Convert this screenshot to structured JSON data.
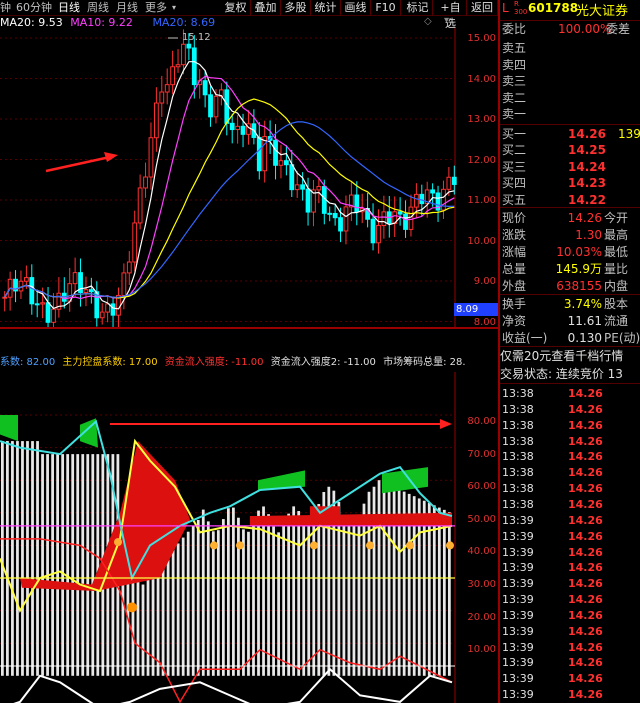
{
  "toolbar": {
    "tabs": [
      "钟",
      "60分钟",
      "日线",
      "周线",
      "月线",
      "更多"
    ],
    "active_tab": "日线",
    "buttons": [
      "复权",
      "叠加",
      "多股",
      "统计",
      "画线",
      "F10",
      "标记",
      "+自选",
      "返回"
    ]
  },
  "main_chart": {
    "ma_labels": [
      {
        "text": "MA20: 9.53",
        "color": "#ffffff"
      },
      {
        "text": "MA10: 9.22",
        "color": "#ff40ff"
      },
      {
        "text": "MA20: 8.69",
        "color": "#3366ff"
      }
    ],
    "high_label": "15.12",
    "current_price_tag": "8.09",
    "price_axis": [
      "15.00",
      "14.00",
      "13.00",
      "12.00",
      "11.00",
      "10.00",
      "9.00",
      "8.00"
    ]
  },
  "indicator": {
    "labels": [
      {
        "text": "系数: 82.00",
        "color": "#4fa0ff"
      },
      {
        "text": "主力控盘系数: 17.00",
        "color": "#ffd000"
      },
      {
        "text": "资金流入强度: -11.00",
        "color": "#ff3030"
      },
      {
        "text": "资金流入强度2: -11.00",
        "color": "#e0e0e0"
      },
      {
        "text": "市场筹码总量: 28.",
        "color": "#e0e0e0"
      }
    ],
    "axis": [
      "80.00",
      "70.00",
      "60.00",
      "50.00",
      "40.00",
      "30.00",
      "20.00",
      "10.00"
    ]
  },
  "quote": {
    "badge": "L",
    "badge_sub": "R 300",
    "code": "601788",
    "name": "光大证券",
    "weibi_label": "委比",
    "weibi_value": "100.00%",
    "weicha_label": "委差",
    "sells": [
      "卖五",
      "卖四",
      "卖三",
      "卖二",
      "卖一"
    ],
    "buys": [
      {
        "label": "买一",
        "price": "14.26",
        "vol": "139"
      },
      {
        "label": "买二",
        "price": "14.25",
        "vol": ""
      },
      {
        "label": "买三",
        "price": "14.24",
        "vol": ""
      },
      {
        "label": "买四",
        "price": "14.23",
        "vol": ""
      },
      {
        "label": "买五",
        "price": "14.22",
        "vol": ""
      }
    ],
    "stats": [
      {
        "l": "现价",
        "v": "14.26",
        "c": "#ff3030",
        "r": "今开"
      },
      {
        "l": "涨跌",
        "v": "1.30",
        "c": "#ff3030",
        "r": "最高"
      },
      {
        "l": "涨幅",
        "v": "10.03%",
        "c": "#ff3030",
        "r": "最低"
      },
      {
        "l": "总量",
        "v": "145.9万",
        "c": "#ffff00",
        "r": "量比"
      },
      {
        "l": "外盘",
        "v": "638155",
        "c": "#ff3030",
        "r": "内盘"
      }
    ],
    "stats2": [
      {
        "l": "换手",
        "v": "3.74%",
        "c": "#ffff00",
        "r": "股本"
      },
      {
        "l": "净资",
        "v": "11.61",
        "c": "#e0e0e0",
        "r": "流通"
      },
      {
        "l": "收益(一)",
        "v": "0.130",
        "c": "#e0e0e0",
        "r": "PE(动)"
      }
    ],
    "notice": "仅需20元查看千档行情",
    "notice_bold": "20",
    "status": "交易状态: 连续竞价 13",
    "trades": [
      {
        "time": "13:38",
        "price": "14.26"
      },
      {
        "time": "13:38",
        "price": "14.26"
      },
      {
        "time": "13:38",
        "price": "14.26"
      },
      {
        "time": "13:38",
        "price": "14.26"
      },
      {
        "time": "13:38",
        "price": "14.26"
      },
      {
        "time": "13:38",
        "price": "14.26"
      },
      {
        "time": "13:38",
        "price": "14.26"
      },
      {
        "time": "13:38",
        "price": "14.26"
      },
      {
        "time": "13:39",
        "price": "14.26"
      },
      {
        "time": "13:39",
        "price": "14.26"
      },
      {
        "time": "13:39",
        "price": "14.26"
      },
      {
        "time": "13:39",
        "price": "14.26"
      },
      {
        "time": "13:39",
        "price": "14.26"
      },
      {
        "time": "13:39",
        "price": "14.26"
      },
      {
        "time": "13:39",
        "price": "14.26"
      },
      {
        "time": "13:39",
        "price": "14.26"
      },
      {
        "time": "13:39",
        "price": "14.26"
      },
      {
        "time": "13:39",
        "price": "14.26"
      },
      {
        "time": "13:39",
        "price": "14.26"
      },
      {
        "time": "13:39",
        "price": "14.26"
      }
    ]
  },
  "colors": {
    "up": "#ff3030",
    "down": "#00ffff",
    "axis": "#e03030",
    "grid": "#550000"
  }
}
